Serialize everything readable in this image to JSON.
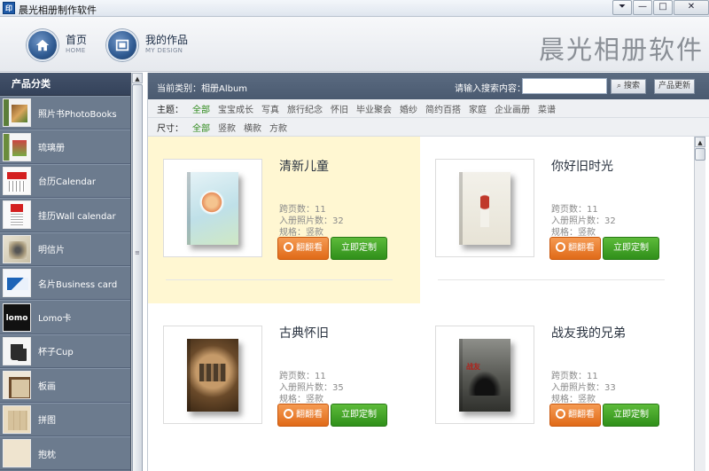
{
  "window": {
    "icon_text": "印",
    "title": "晨光相册制作软件",
    "controls": [
      "⏷",
      "—",
      "□",
      "✕"
    ]
  },
  "header": {
    "nav": [
      {
        "cn": "首页",
        "en": "HOME"
      },
      {
        "cn": "我的作品",
        "en": "MY DESIGN"
      }
    ],
    "brand": "晨光相册软件"
  },
  "sidebar": {
    "heading": "产品分类",
    "items": [
      {
        "label": "照片书PhotoBooks"
      },
      {
        "label": "琉璃册"
      },
      {
        "label": "台历Calendar"
      },
      {
        "label": "挂历Wall calendar"
      },
      {
        "label": "明信片"
      },
      {
        "label": "名片Business card"
      },
      {
        "label": "Lomo卡",
        "thumb_text": "lomo"
      },
      {
        "label": "杯子Cup"
      },
      {
        "label": "板画"
      },
      {
        "label": "拼图"
      },
      {
        "label": "抱枕"
      }
    ]
  },
  "toolbar": {
    "current_category": "当前类别：相册Album",
    "search_label": "请输入搜索内容：",
    "search_value": "",
    "search_button": "搜索",
    "update_button": "产品更新"
  },
  "filters": {
    "theme_label": "主题：",
    "themes": [
      "全部",
      "宝宝成长",
      "写真",
      "旅行纪念",
      "怀旧",
      "毕业聚会",
      "婚纱",
      "简约百搭",
      "家庭",
      "企业画册",
      "菜谱"
    ],
    "size_label": "尺寸：",
    "sizes": [
      "全部",
      "竖款",
      "横款",
      "方款"
    ]
  },
  "products": [
    {
      "title": "清新儿童",
      "pages": "跨页数：11",
      "photos": "入册照片数：32",
      "spec": "规格：竖款",
      "preview": "翻翻看",
      "order": "立即定制"
    },
    {
      "title": "你好旧时光",
      "pages": "跨页数：11",
      "photos": "入册照片数：32",
      "spec": "规格：竖款",
      "preview": "翻翻看",
      "order": "立即定制"
    },
    {
      "title": "古典怀旧",
      "pages": "跨页数：11",
      "photos": "入册照片数：35",
      "spec": "规格：竖款",
      "preview": "翻翻看",
      "order": "立即定制"
    },
    {
      "title": "战友我的兄弟",
      "pages": "跨页数：11",
      "photos": "入册照片数：33",
      "spec": "规格：竖款",
      "preview": "翻翻看",
      "order": "立即定制",
      "cover_text": "战友"
    }
  ],
  "colors": {
    "accent_green": "#2f8a1c",
    "highlight": "#fff7d2",
    "sidebar_bg": "#6c7b8e",
    "toolbar_bg": "#4a5a70"
  }
}
